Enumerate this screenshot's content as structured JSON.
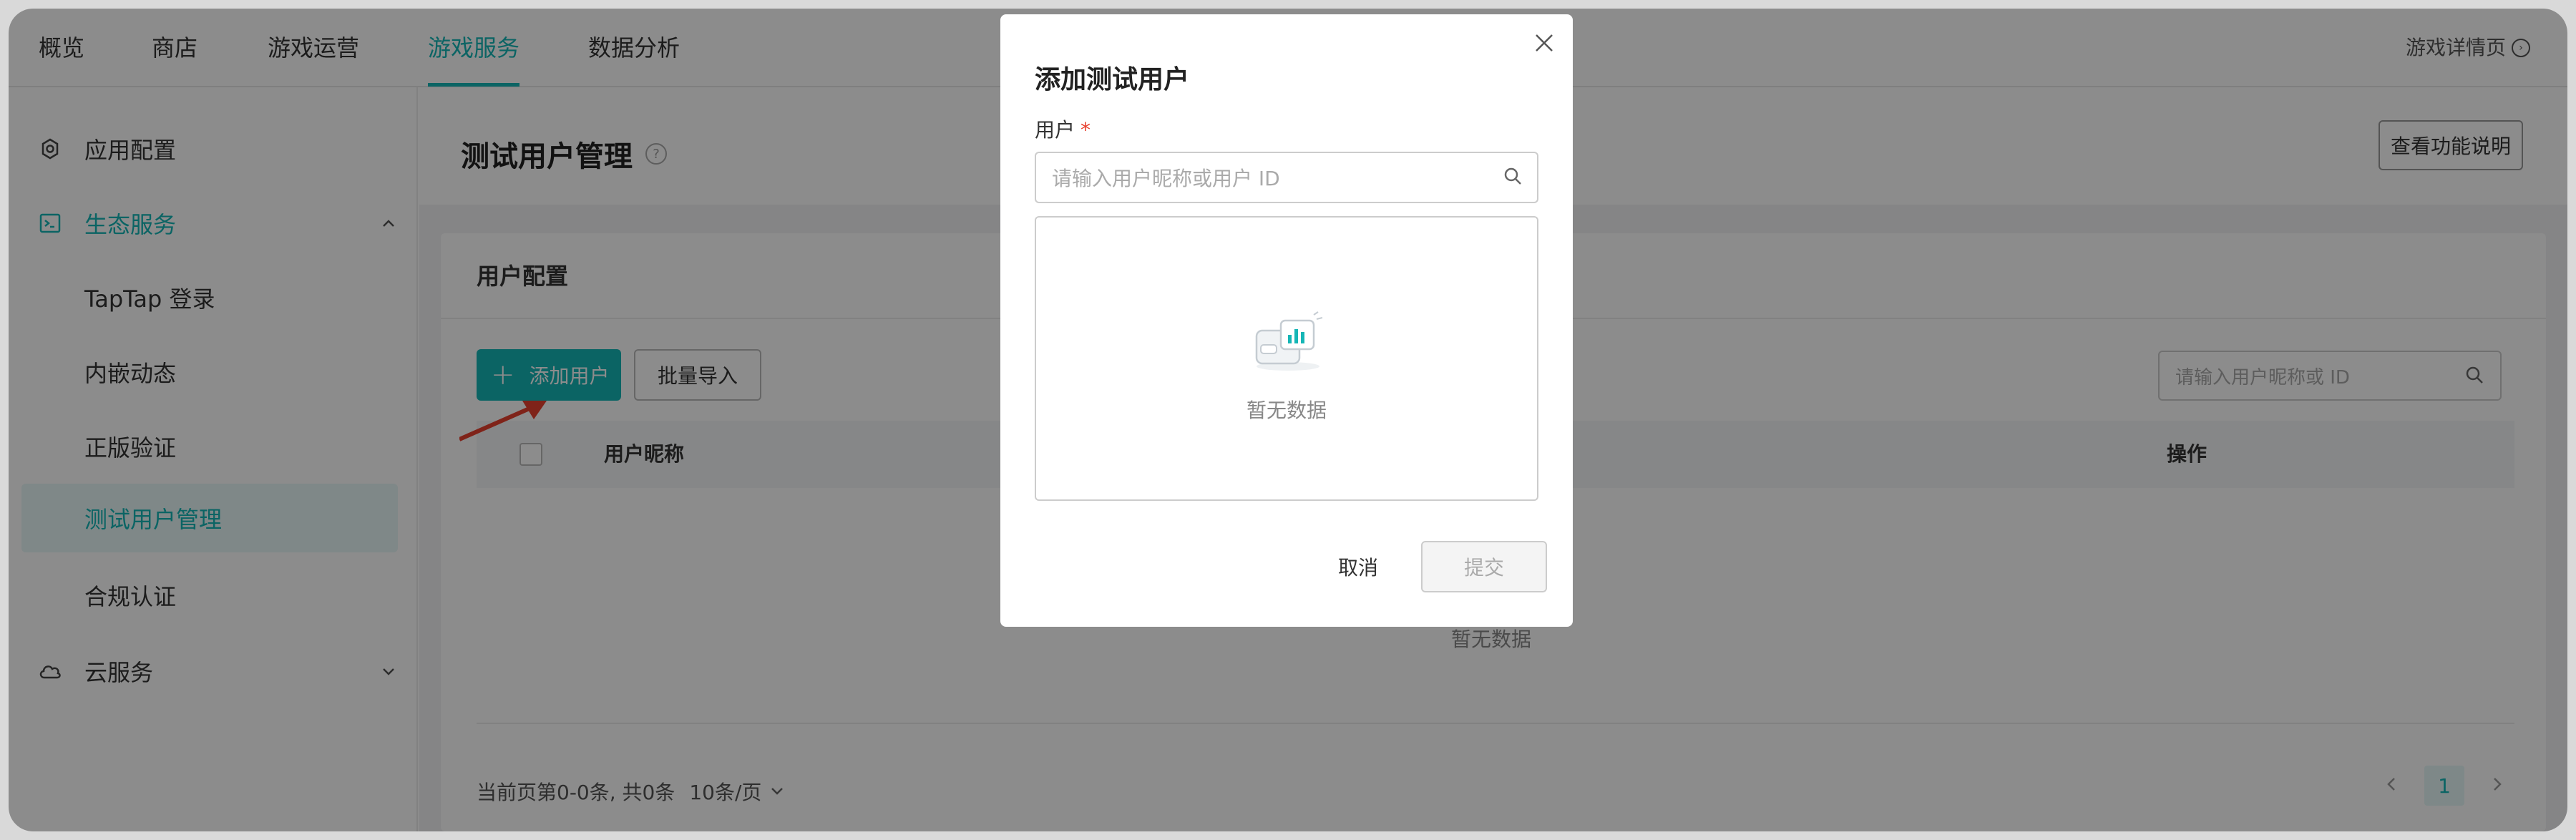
{
  "topnav": {
    "items": [
      {
        "label": "概览"
      },
      {
        "label": "商店"
      },
      {
        "label": "游戏运营"
      },
      {
        "label": "游戏服务"
      },
      {
        "label": "数据分析"
      }
    ],
    "detail_link": "游戏详情页"
  },
  "sidebar": {
    "items": [
      {
        "label": "应用配置"
      },
      {
        "label": "生态服务"
      },
      {
        "label": "TapTap 登录"
      },
      {
        "label": "内嵌动态"
      },
      {
        "label": "正版验证"
      },
      {
        "label": "测试用户管理"
      },
      {
        "label": "合规认证"
      },
      {
        "label": "云服务"
      }
    ]
  },
  "page": {
    "title": "测试用户管理",
    "func_button": "查看功能说明",
    "card_title": "用户配置",
    "add_button": "添加用户",
    "import_button": "批量导入",
    "search_placeholder": "请输入用户昵称或 ID",
    "columns": {
      "name": "用户昵称",
      "ops": "操作"
    },
    "empty": "暂无数据",
    "footer_info": "当前页第0-0条, 共0条",
    "page_size": "10条/页",
    "current_page": "1"
  },
  "modal": {
    "title": "添加测试用户",
    "field_label": "用户",
    "required_mark": "*",
    "input_placeholder": "请输入用户昵称或用户 ID",
    "empty": "暂无数据",
    "cancel": "取消",
    "submit": "提交"
  },
  "colors": {
    "accent": "#15b6b6",
    "required": "#e8412f",
    "annotation_arrow": "#e8412f"
  }
}
